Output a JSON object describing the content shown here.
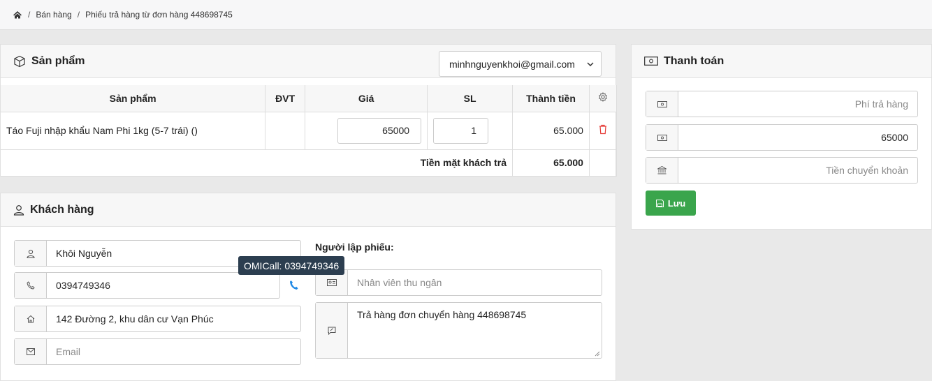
{
  "breadcrumb": {
    "items": [
      "Bán hàng",
      "Phiếu trả hàng từ đơn hàng 448698745"
    ],
    "separator": "/"
  },
  "products": {
    "title": "Sản phẩm",
    "account": "minhnguyenkhoi@gmail.com",
    "columns": [
      "Sản phẩm",
      "ĐVT",
      "Giá",
      "SL",
      "Thành tiền"
    ],
    "rows": [
      {
        "name": "Táo Fuji nhập khẩu Nam Phi 1kg (5-7 trái) ()",
        "unit": "",
        "price": "65000",
        "qty": "1",
        "total": "65.000"
      }
    ],
    "total_label": "Tiền mặt khách trả",
    "total_value": "65.000"
  },
  "customer": {
    "title": "Khách hàng",
    "name": "Khôi Nguyễn",
    "phone": "0394749346",
    "address": "142 Đường 2, khu dân cư Vạn Phúc",
    "email_placeholder": "Email",
    "creator_label": "Người lập phiếu:",
    "cashier_placeholder": "Nhân viên thu ngân",
    "note": "Trả hàng đơn chuyển hàng 448698745",
    "tooltip": "OMICall: 0394749346"
  },
  "payment": {
    "title": "Thanh toán",
    "fee_placeholder": "Phí trả hàng",
    "cash_value": "65000",
    "transfer_placeholder": "Tiền chuyển khoản",
    "save_label": "Lưu"
  },
  "colors": {
    "save": "#3aa54c",
    "delete": "#e53935",
    "phone_icon": "#1e88e5",
    "tooltip_bg": "#2c3e50"
  }
}
